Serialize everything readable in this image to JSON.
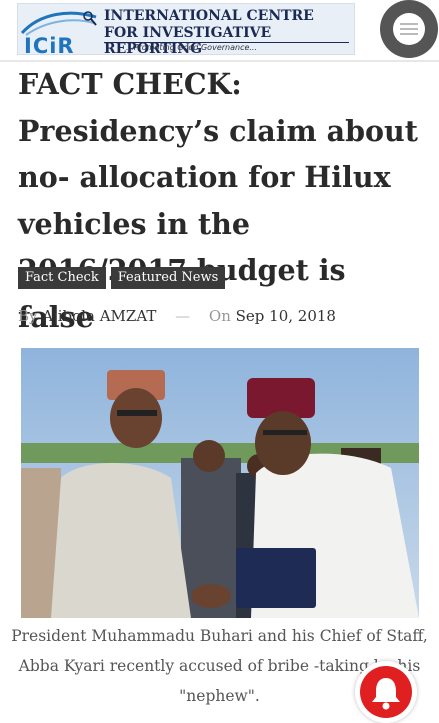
{
  "header": {
    "logo": {
      "short_name": "ICiR",
      "line1": "INTERNATIONAL CENTRE",
      "line2": "FOR INVESTIGATIVE REPORTING",
      "tagline": "...Promoting Good Governance..."
    },
    "menu_icon": "menu-icon"
  },
  "article": {
    "title": "FACT CHECK: Presidency’s claim about no- allocation for Hilux vehicles in the 2016/2017 budget is false",
    "tags": [
      "Fact Check",
      "Featured News"
    ],
    "byline_prefix": "By",
    "author": "Ajibola AMZAT",
    "dash": "—",
    "date_prefix": "On",
    "date": "Sep 10, 2018",
    "caption": "President Muhammadu Buhari and his Chief of Staff, Abba Kyari recently accused of bribe -taking by his \"nephew\"."
  },
  "notification": {
    "icon": "bell-icon",
    "color": "#e02020"
  },
  "colors": {
    "brand_blue": "#1f74bd",
    "tag_bg": "#3a3a3a"
  }
}
